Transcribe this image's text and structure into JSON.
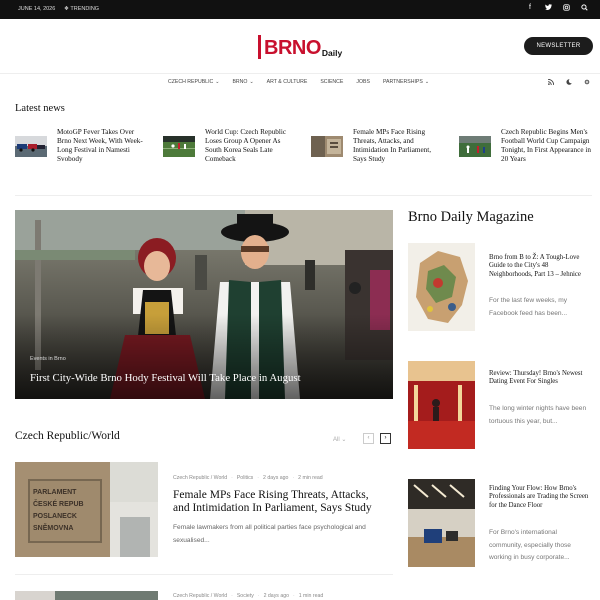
{
  "topbar": {
    "date": "JUNE 14, 2026",
    "trending": "❖ TRENDING",
    "social_icons": [
      "facebook-icon",
      "twitter-icon",
      "instagram-icon",
      "search-icon"
    ]
  },
  "header": {
    "logo_main": "BRNO",
    "logo_sub": "Daily",
    "newsletter_label": "NEWSLETTER"
  },
  "nav": {
    "items": [
      {
        "label": "CZECH REPUBLIC",
        "dropdown": true
      },
      {
        "label": "BRNO",
        "dropdown": true
      },
      {
        "label": "ART & CULTURE",
        "dropdown": false
      },
      {
        "label": "SCIENCE",
        "dropdown": false
      },
      {
        "label": "JOBS",
        "dropdown": false
      },
      {
        "label": "PARTNERSHIPS",
        "dropdown": true
      }
    ]
  },
  "latest": {
    "title": "Latest news",
    "items": [
      {
        "title": "MotoGP Fever Takes Over Brno Next Week, With Week-Long Festival in Namesti Svobody"
      },
      {
        "title": "World Cup: Czech Republic Loses Group A Opener As South Korea Seals Late Comeback"
      },
      {
        "title": "Female MPs Face Rising Threats, Attacks, and Intimidation In Parliament, Says Study"
      },
      {
        "title": "Czech Republic Begins Men's Football World Cup Campaign Tonight, In First Appearance in 20 Years"
      }
    ]
  },
  "hero": {
    "category": "Events in Brno",
    "title": "First City-Wide Brno Hody Festival Will Take Place in August"
  },
  "czworld": {
    "title": "Czech Republic/World",
    "filter": "All",
    "articles": [
      {
        "cat1": "Czech Republic / World",
        "cat2": "Politics",
        "time": "2 days ago",
        "read": "2 min read",
        "title": "Female MPs Face Rising Threats, Attacks, and Intimidation In Parliament, Says Study",
        "excerpt": "Female lawmakers from all political parties face psychological and sexualised..."
      },
      {
        "cat1": "Czech Republic / World",
        "cat2": "Society",
        "time": "2 days ago",
        "read": "1 min read"
      }
    ]
  },
  "magazine": {
    "title": "Brno Daily Magazine",
    "items": [
      {
        "title": "Brno from B to Ž: A Tough-Love Guide to the City's 48 Neighborhoods, Part 13 – Jehnice",
        "excerpt": "For the last few weeks, my Facebook feed has been..."
      },
      {
        "title": "Review: Thursday! Brno's Newest Dating Event For Singles",
        "excerpt": "The long winter nights have been tortuous this year, but..."
      },
      {
        "title": "Finding Your Flow: How Brno's Professionals are Trading the Screen for the Dance Floor",
        "excerpt": "For Brno's international community, especially those working in busy corporate..."
      }
    ]
  }
}
